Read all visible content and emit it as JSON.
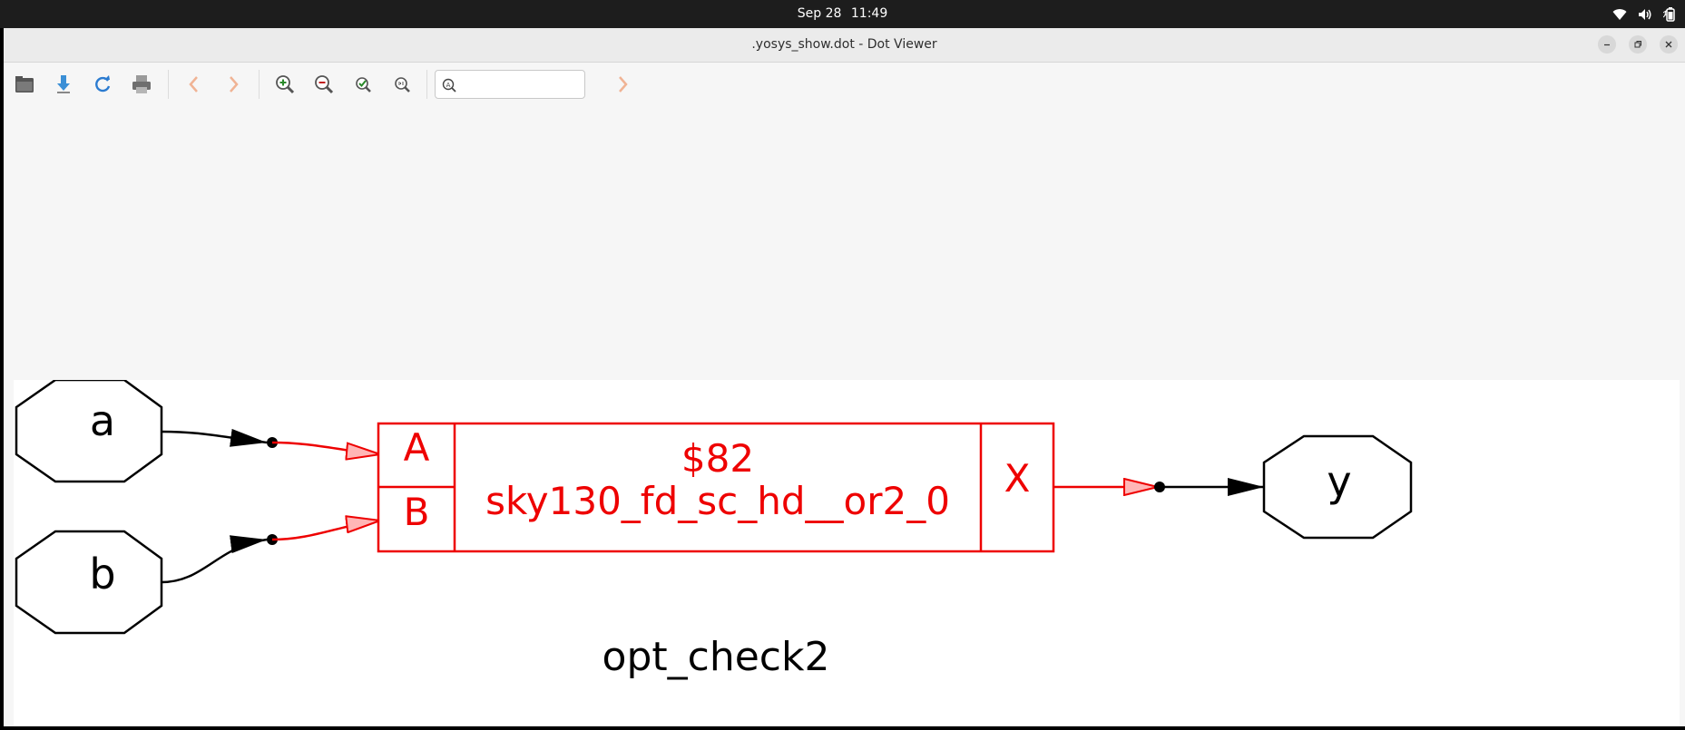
{
  "system": {
    "date": "Sep 28",
    "time": "11:49"
  },
  "window": {
    "title": ".yosys_show.dot - Dot Viewer"
  },
  "toolbar": {
    "search_value": "",
    "icons": [
      "open-icon",
      "save-icon",
      "reload-icon",
      "print-icon",
      "back-icon",
      "forward-icon",
      "zoom-in-icon",
      "zoom-out-icon",
      "zoom-fit-icon",
      "zoom-100-icon",
      "find-icon",
      "find-next-icon"
    ]
  },
  "graph": {
    "name": "opt_check2",
    "inputs": [
      {
        "id": "a",
        "label": "a"
      },
      {
        "id": "b",
        "label": "b"
      }
    ],
    "output": {
      "id": "y",
      "label": "y"
    },
    "cell": {
      "id": "$82",
      "type": "sky130_fd_sc_hd__or2_0",
      "ports_in": [
        "A",
        "B"
      ],
      "port_out": "X"
    },
    "colors": {
      "cell": "#ee0000",
      "net": "#000000",
      "arrow_fill_cell": "#ffb6b6"
    }
  }
}
